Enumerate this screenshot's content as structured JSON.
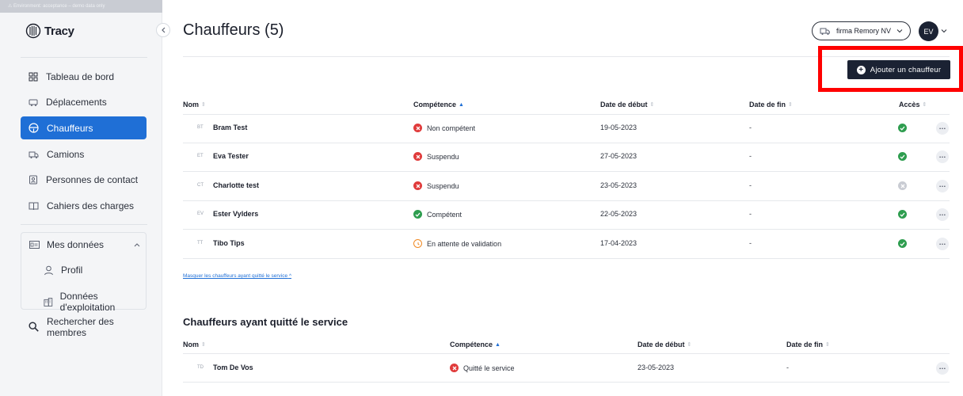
{
  "sidebar": {
    "banner": "⚠ Environment: acceptance – demo data only",
    "logo_text": "Tracy",
    "items": [
      {
        "label": "Tableau de bord",
        "icon": "dashboard-icon"
      },
      {
        "label": "Déplacements",
        "icon": "trips-icon"
      },
      {
        "label": "Chauffeurs",
        "icon": "steering-wheel-icon",
        "active": true
      },
      {
        "label": "Camions",
        "icon": "truck-icon"
      },
      {
        "label": "Personnes de contact",
        "icon": "contact-icon"
      },
      {
        "label": "Cahiers des charges",
        "icon": "book-icon"
      }
    ],
    "data_section": {
      "label": "Mes données",
      "sub_items": [
        {
          "label": "Profil",
          "icon": "user-icon"
        },
        {
          "label": "Données d'exploitation",
          "icon": "building-icon"
        }
      ]
    },
    "search_label": "Rechercher des membres"
  },
  "header": {
    "title": "Chauffeurs (5)",
    "company": "firma Remory NV",
    "avatar_initials": "EV",
    "add_button": "Ajouter un chauffeur"
  },
  "drivers_table": {
    "columns": [
      "Nom",
      "Compétence",
      "Date de début",
      "Date de fin",
      "Accès"
    ],
    "rows": [
      {
        "initials": "BT",
        "name": "Bram Test",
        "status": "Non compétent",
        "status_type": "error",
        "start": "19-05-2023",
        "end": "-",
        "access": "green"
      },
      {
        "initials": "ET",
        "name": "Eva Tester",
        "status": "Suspendu",
        "status_type": "error",
        "start": "27-05-2023",
        "end": "-",
        "access": "green"
      },
      {
        "initials": "CT",
        "name": "Charlotte test",
        "status": "Suspendu",
        "status_type": "error",
        "start": "23-05-2023",
        "end": "-",
        "access": "grey"
      },
      {
        "initials": "EV",
        "name": "Ester Vylders",
        "status": "Compétent",
        "status_type": "ok",
        "start": "22-05-2023",
        "end": "-",
        "access": "green"
      },
      {
        "initials": "TT",
        "name": "Tibo Tips",
        "status": "En attente de validation",
        "status_type": "pending",
        "start": "17-04-2023",
        "end": "-",
        "access": "green"
      }
    ]
  },
  "hide_link": "Masquer les chauffeurs ayant quitté le service",
  "former_section": {
    "title": "Chauffeurs ayant quitté le service",
    "columns": [
      "Nom",
      "Compétence",
      "Date de début",
      "Date de fin"
    ],
    "rows": [
      {
        "initials": "TD",
        "name": "Tom De Vos",
        "status": "Quitté le service",
        "status_type": "error",
        "start": "23-05-2023",
        "end": "-"
      }
    ]
  },
  "colors": {
    "accent": "#1f6fd6",
    "dark": "#1b2233",
    "error": "#e03b3b",
    "ok": "#2e9d4f",
    "pending": "#f08a24",
    "highlight": "#ff0000"
  }
}
